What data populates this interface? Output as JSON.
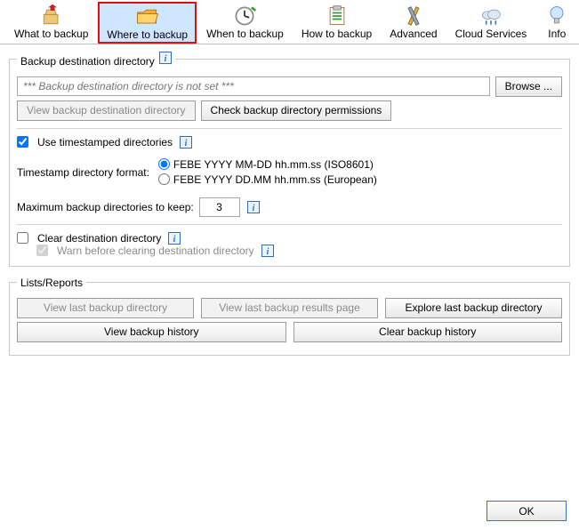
{
  "tabs": [
    {
      "label": "What to backup"
    },
    {
      "label": "Where to backup"
    },
    {
      "label": "When to backup"
    },
    {
      "label": "How to backup"
    },
    {
      "label": "Advanced"
    },
    {
      "label": "Cloud Services"
    },
    {
      "label": "Info"
    }
  ],
  "dest": {
    "legend": "Backup destination directory",
    "placeholder": "*** Backup destination directory is not set ***",
    "browse_label": "Browse ...",
    "view_dir_label": "View backup destination directory",
    "check_perm_label": "Check backup directory permissions",
    "timestamp": {
      "use_label": "Use timestamped directories",
      "format_label": "Timestamp directory format:",
      "opt_iso": "FEBE YYYY MM-DD hh.mm.ss (ISO8601)",
      "opt_eu": "FEBE YYYY DD.MM hh.mm.ss (European)",
      "max_label": "Maximum backup directories to keep:",
      "max_value": "3"
    },
    "clear": {
      "label": "Clear destination directory",
      "warn_label": "Warn before clearing destination directory"
    }
  },
  "reports": {
    "legend": "Lists/Reports",
    "view_last_dir": "View last backup directory",
    "view_last_results": "View last backup results page",
    "explore_last": "Explore last backup directory",
    "view_history": "View backup history",
    "clear_history": "Clear backup history"
  },
  "footer": {
    "ok": "OK"
  }
}
